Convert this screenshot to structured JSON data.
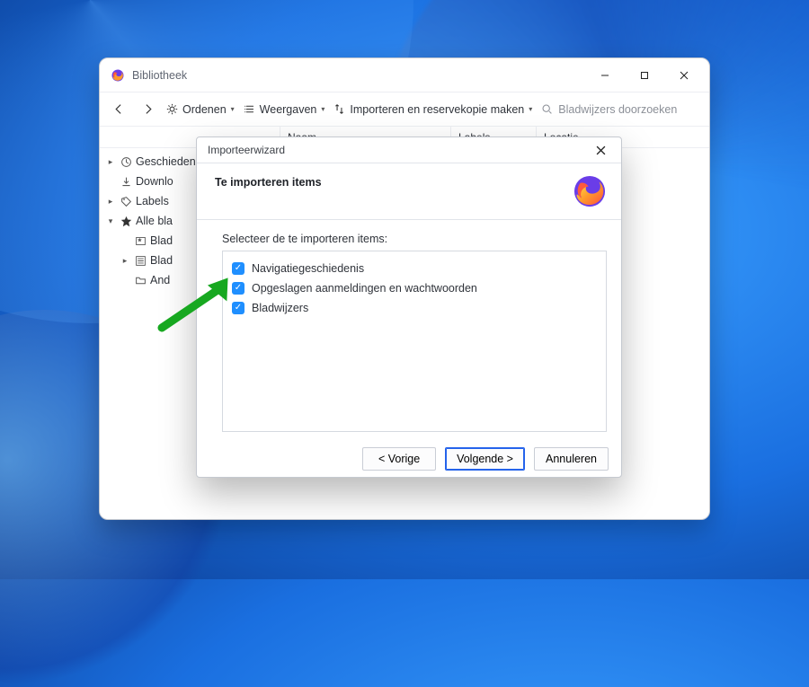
{
  "window": {
    "title": "Bibliotheek",
    "toolbar": {
      "ordenen": "Ordenen",
      "weergaven": "Weergaven",
      "importeren": "Importeren en reservekopie maken",
      "search_placeholder": "Bladwijzers doorzoeken"
    },
    "columns": {
      "name": "Naam",
      "labels": "Labels",
      "location": "Locatie"
    },
    "tree": {
      "history": "Geschiedenis",
      "downloads": "Downlo",
      "labels": "Labels",
      "allbm": "Alle bla",
      "child1": "Blad",
      "child2": "Blad",
      "child3": "And"
    }
  },
  "dialog": {
    "title": "Importeerwizard",
    "heading": "Te importeren items",
    "prompt": "Selecteer de te importeren items:",
    "items": {
      "history": "Navigatiegeschiedenis",
      "logins": "Opgeslagen aanmeldingen en wachtwoorden",
      "bookmarks": "Bladwijzers"
    },
    "buttons": {
      "back": "< Vorige",
      "next": "Volgende >",
      "cancel": "Annuleren"
    }
  }
}
